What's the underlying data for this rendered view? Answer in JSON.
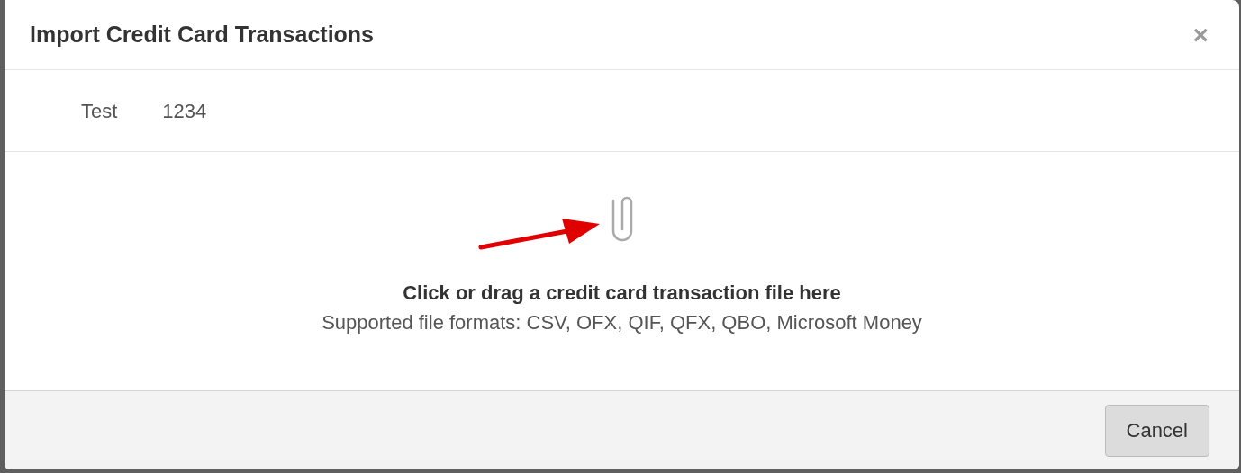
{
  "dialog": {
    "title": "Import Credit Card Transactions",
    "close": "×"
  },
  "account": {
    "name": "Test",
    "number": "1234"
  },
  "dropzone": {
    "heading": "Click or drag a credit card transaction file here",
    "formats": "Supported file formats: CSV, OFX, QIF, QFX, QBO, Microsoft Money"
  },
  "buttons": [
    {
      "label": "Cancel"
    }
  ]
}
